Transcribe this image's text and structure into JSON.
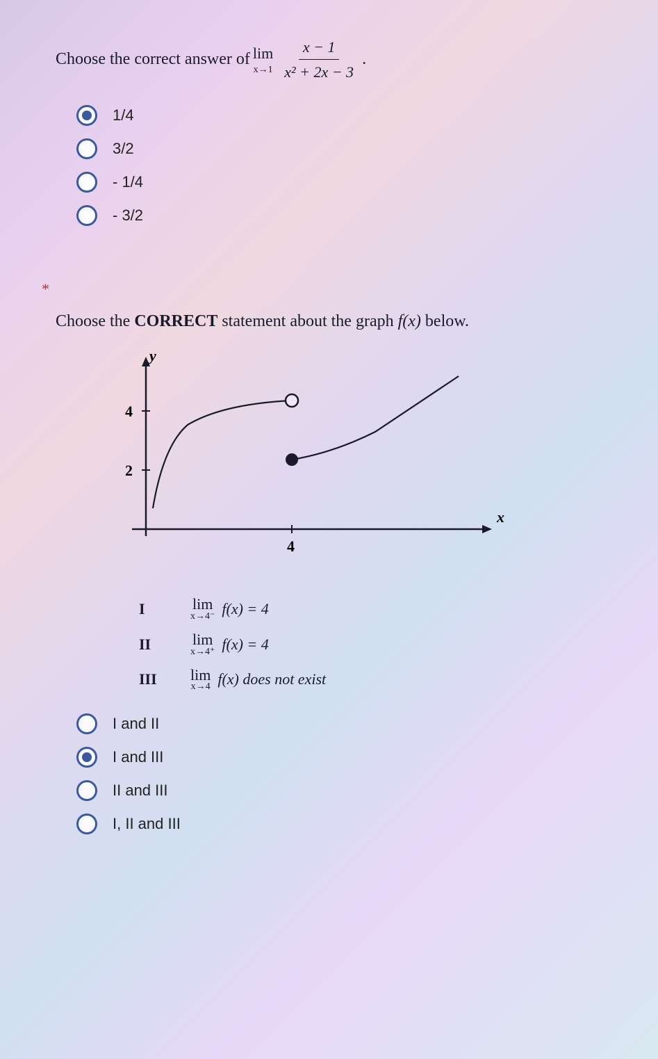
{
  "q1": {
    "prompt_prefix": "Choose the correct answer of ",
    "lim_label": "lim",
    "lim_sub": "x→1",
    "numerator": "x − 1",
    "denominator": "x² + 2x − 3",
    "period": ".",
    "options": [
      "1/4",
      "3/2",
      "- 1/4",
      "- 3/2"
    ],
    "selected_index": 0
  },
  "required_marker": "*",
  "q2": {
    "prompt_prefix": "Choose the ",
    "prompt_bold": "CORRECT",
    "prompt_suffix": " statement about the graph ",
    "fx": "f(x)",
    "prompt_tail": " below.",
    "graph": {
      "y_label": "y",
      "x_label": "x",
      "y_ticks": [
        "4",
        "2"
      ],
      "x_ticks": [
        "4"
      ]
    },
    "statements": {
      "I": {
        "roman": "I",
        "lim": "lim",
        "sub": "x→4⁻",
        "expr": "f(x) = 4"
      },
      "II": {
        "roman": "II",
        "lim": "lim",
        "sub": "x→4⁺",
        "expr": "f(x) = 4"
      },
      "III": {
        "roman": "III",
        "lim": "lim",
        "sub": "x→4",
        "expr": "f(x) does not exist"
      }
    },
    "options": [
      "I and II",
      "I and III",
      "II and III",
      "I, II and III"
    ],
    "selected_index": 1
  },
  "chart_data": {
    "type": "line",
    "title": "",
    "xlabel": "x",
    "ylabel": "y",
    "xlim": [
      0,
      9
    ],
    "ylim": [
      0,
      6
    ],
    "x_ticks": [
      4
    ],
    "y_ticks": [
      2,
      4
    ],
    "series": [
      {
        "name": "left-branch",
        "x": [
          0.5,
          1,
          2,
          3,
          4
        ],
        "y": [
          1.2,
          2.5,
          3.6,
          4.1,
          4.4
        ],
        "end_open_at": [
          4,
          4.4
        ]
      },
      {
        "name": "right-branch",
        "x": [
          4,
          5,
          6,
          7,
          8
        ],
        "y": [
          2.6,
          2.9,
          3.4,
          4.4,
          5.2
        ],
        "start_closed_at": [
          4,
          2.6
        ]
      }
    ],
    "annotations": [
      {
        "type": "open-circle",
        "x": 4,
        "y": 4.4
      },
      {
        "type": "closed-circle",
        "x": 4,
        "y": 2.6
      }
    ]
  }
}
